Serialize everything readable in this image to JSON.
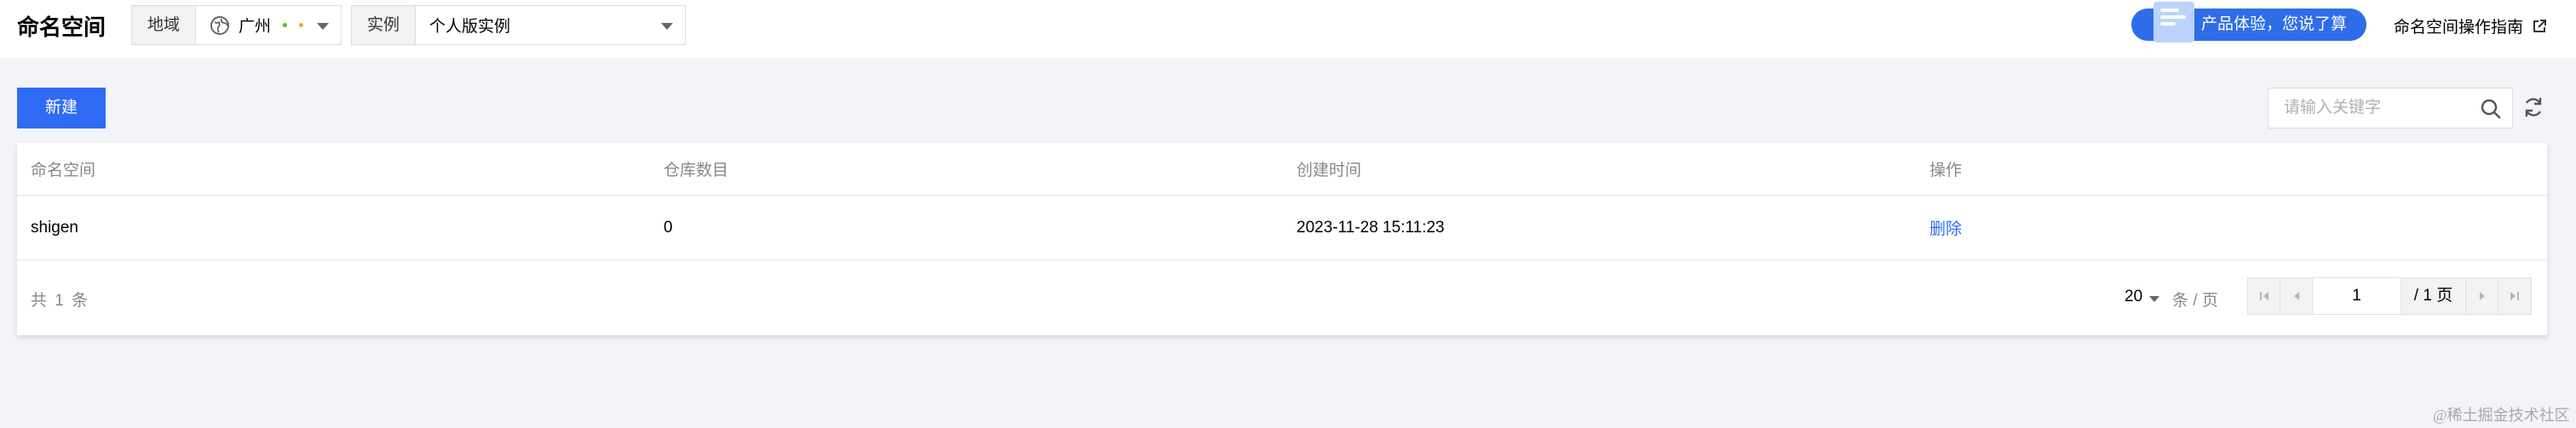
{
  "header": {
    "title": "命名空间",
    "region_label": "地域",
    "region_value": "广州",
    "instance_label": "实例",
    "instance_value": "个人版实例",
    "feedback_text": "产品体验，您说了算",
    "guide_link": "命名空间操作指南"
  },
  "toolbar": {
    "new_button": "新建",
    "search_placeholder": "请输入关键字"
  },
  "table": {
    "columns": [
      "命名空间",
      "仓库数目",
      "创建时间",
      "操作"
    ],
    "rows": [
      {
        "namespace": "shigen",
        "repo_count": "0",
        "created": "2023-11-28 15:11:23",
        "action": "删除"
      }
    ]
  },
  "pagination": {
    "total_text": "共 1 条",
    "page_size": "20",
    "page_size_unit": "条 / 页",
    "current_page": "1",
    "total_pages": "/ 1 页"
  },
  "watermark": "@稀土掘金技术社区",
  "colors": {
    "primary": "#2f6bf5",
    "background": "#f3f4f7",
    "region_dot_green": "#52c41a",
    "region_dot_orange": "#f5a623"
  }
}
